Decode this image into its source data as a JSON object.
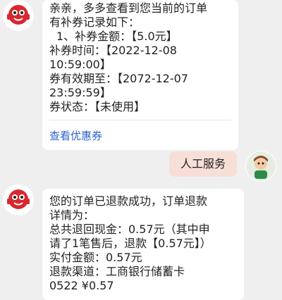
{
  "messages": [
    {
      "side": "left",
      "lines": [
        "亲亲，多多查看到您当前的订单",
        "有补券记录如下：",
        "  1、补券金额：【5.0元】",
        "补券时间：【2022-12-08",
        "10:59:00】",
        "券有效期至：【2072-12-07",
        "23:59:59】",
        "券状态：【未使用】"
      ],
      "link": "查看优惠券"
    },
    {
      "side": "right",
      "text": "人工服务"
    },
    {
      "side": "left",
      "lines": [
        "您的订单已退款成功，订单退款",
        "详情为：",
        "总共退回现金：0.57元（其中申",
        "请了1笔售后，退款【0.57元】）",
        "实付金额：0.57元",
        "退款渠道：工商银行储蓄卡",
        "0522 ¥0.57"
      ]
    }
  ],
  "colors": {
    "background": "#efefef",
    "bubble_left": "#ffffff",
    "bubble_right": "#f7dfd8",
    "link": "#2c63c9",
    "bot_avatar_red": "#d8282f"
  },
  "icons": {
    "bot_avatar": "red-bot-avatar-icon",
    "user_avatar": "user-avatar-icon"
  }
}
